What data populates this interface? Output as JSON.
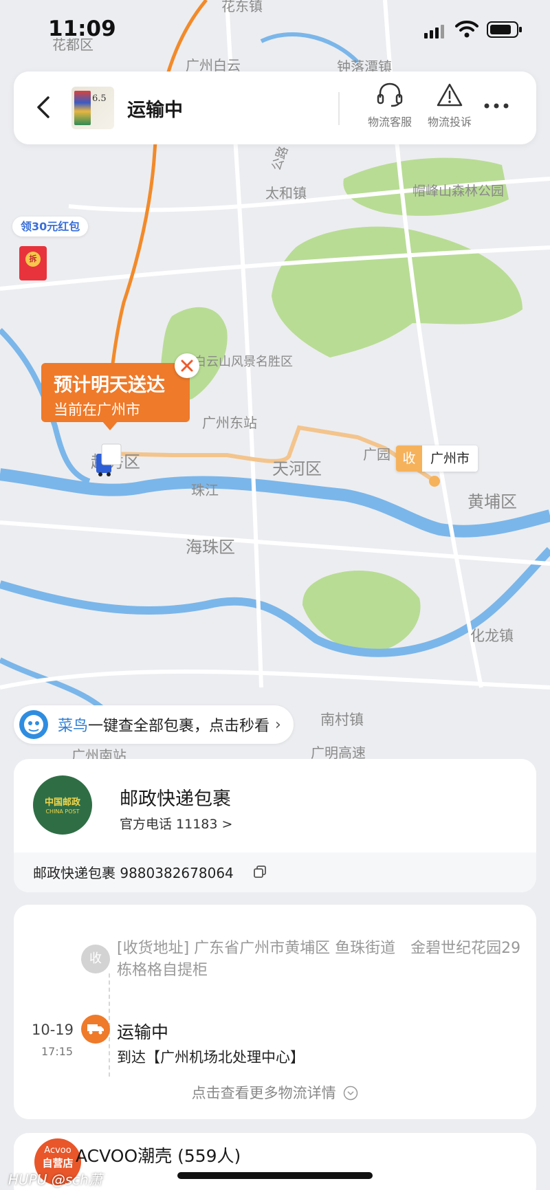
{
  "status_bar": {
    "time": "11:09"
  },
  "header": {
    "title": "运输中",
    "product_thumb_number": "6.5",
    "customer_service_label": "物流客服",
    "complaint_label": "物流投诉"
  },
  "map": {
    "coupon_label": "领30元红包",
    "coupon_seal": "拆",
    "eta_title": "预计明天送达",
    "eta_subtitle": "当前在广州市",
    "destination_tag": "收",
    "destination_city": "广州市",
    "labels": {
      "huadu": "花都区",
      "huadong": "花东镇",
      "baiyun": "广州白云",
      "zhongluotan": "钟落潭镇",
      "road": "公路",
      "taihe": "太和镇",
      "maofengshan": "帽峰山森林公园",
      "baiyunshan": "白云山风景名胜区",
      "dongzhan": "广州东站",
      "yuexiu": "越秀区",
      "tianhe": "天河区",
      "guangyuan": "广园",
      "zhujiang": "珠江",
      "huangpu": "黄埔区",
      "haizhu": "海珠区",
      "hualong": "化龙镇",
      "nancun": "南村镇",
      "nanzhan": "广州南站",
      "guangming": "广明高速"
    }
  },
  "cainiao_banner": {
    "brand": "菜鸟",
    "text": "一键查全部包裹，点击秒看",
    "chevron": "›"
  },
  "courier": {
    "logo_cn": "中国邮政",
    "logo_en": "CHINA POST",
    "name": "邮政快递包裹",
    "phone": "官方电话 11183 >",
    "tracking": "邮政快递包裹 9880382678064"
  },
  "timeline": {
    "address_tag": "收",
    "address": "[收货地址] 广东省广州市黄埔区 鱼珠街道　金碧世纪花园29栋格格自提柜",
    "date": "10-19",
    "time": "17:15",
    "status": "运输中",
    "detail": "到达【广州机场北处理中心】",
    "more_label": "点击查看更多物流详情"
  },
  "shop": {
    "logo_top": "Acvoo",
    "logo_bottom": "自营店",
    "name": "ACVOO潮壳 (559人)"
  },
  "watermark": "HUPU @sch萧"
}
